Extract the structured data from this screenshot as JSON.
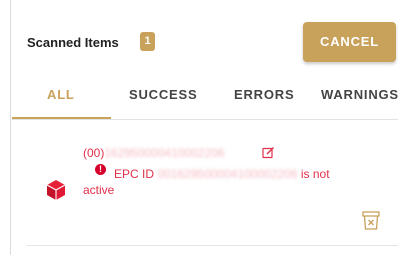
{
  "header": {
    "title": "Scanned Items",
    "count": "1",
    "cancel_label": "CANCEL"
  },
  "tabs": [
    {
      "label": "ALL",
      "active": true
    },
    {
      "label": "SUCCESS",
      "active": false
    },
    {
      "label": "ERRORS",
      "active": false
    },
    {
      "label": "WARNINGS",
      "active": false
    }
  ],
  "items": [
    {
      "code_prefix": "(00)",
      "code_redacted": "162950000410002206",
      "error_icon_text": "!",
      "error_prefix": "EPC ID",
      "error_redacted": "001629500004100002206",
      "error_suffix": "is not",
      "error_line2": "active",
      "status": "error",
      "icons": {
        "item": "cube-icon",
        "edit": "edit-icon",
        "error": "error-icon",
        "delete": "delete-icon"
      }
    }
  ],
  "colors": {
    "accent": "#c8a15a",
    "error": "#e0304a",
    "text": "#222222",
    "tab_inactive": "#444444"
  }
}
